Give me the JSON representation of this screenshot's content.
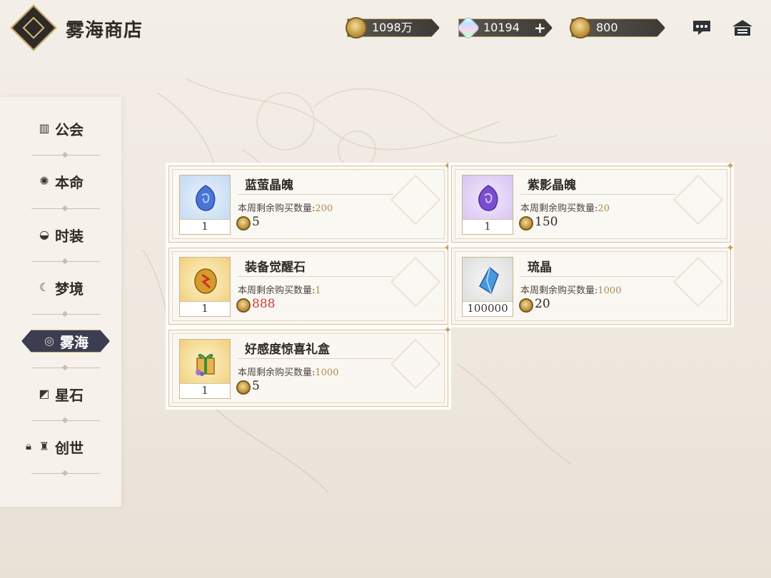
{
  "header": {
    "title": "雾海商店",
    "currencies": [
      {
        "icon": "gold-coin-icon",
        "value": "1098万"
      },
      {
        "icon": "crystal-icon",
        "value": "10194",
        "add_symbol": "+"
      },
      {
        "icon": "mist-coin-icon",
        "value": "800"
      }
    ]
  },
  "sidebar": {
    "items": [
      {
        "label": "公会",
        "icon": "guild-icon"
      },
      {
        "label": "本命",
        "icon": "destiny-icon"
      },
      {
        "label": "时装",
        "icon": "fashion-icon"
      },
      {
        "label": "梦境",
        "icon": "dream-icon"
      },
      {
        "label": "雾海",
        "icon": "mist-sea-icon",
        "active": true
      },
      {
        "label": "星石",
        "icon": "starstone-icon"
      },
      {
        "label": "创世",
        "icon": "genesis-icon",
        "locked": true
      }
    ]
  },
  "shop": {
    "limit_label": "本周剩余购买数量:",
    "items": [
      {
        "name": "蓝萤晶魄",
        "qty": "1",
        "limit": "200",
        "price": "5",
        "price_insufficient": false,
        "icon": "blue-soul-crystal-icon"
      },
      {
        "name": "紫影晶魄",
        "qty": "1",
        "limit": "20",
        "price": "150",
        "price_insufficient": false,
        "icon": "purple-soul-crystal-icon"
      },
      {
        "name": "装备觉醒石",
        "qty": "1",
        "limit": "1",
        "price": "888",
        "price_insufficient": true,
        "icon": "awakening-stone-icon"
      },
      {
        "name": "琉晶",
        "qty": "100000",
        "limit": "1000",
        "price": "20",
        "price_insufficient": false,
        "icon": "glaze-crystal-icon"
      },
      {
        "name": "好感度惊喜礼盒",
        "qty": "1",
        "limit": "1000",
        "price": "5",
        "price_insufficient": false,
        "icon": "gift-box-icon"
      }
    ]
  },
  "colors": {
    "accent_gold": "#c7a867",
    "active_nav_bg": "#3b3d52",
    "insufficient_price": "#cc3a3a",
    "limit_number": "#b08a4a"
  }
}
